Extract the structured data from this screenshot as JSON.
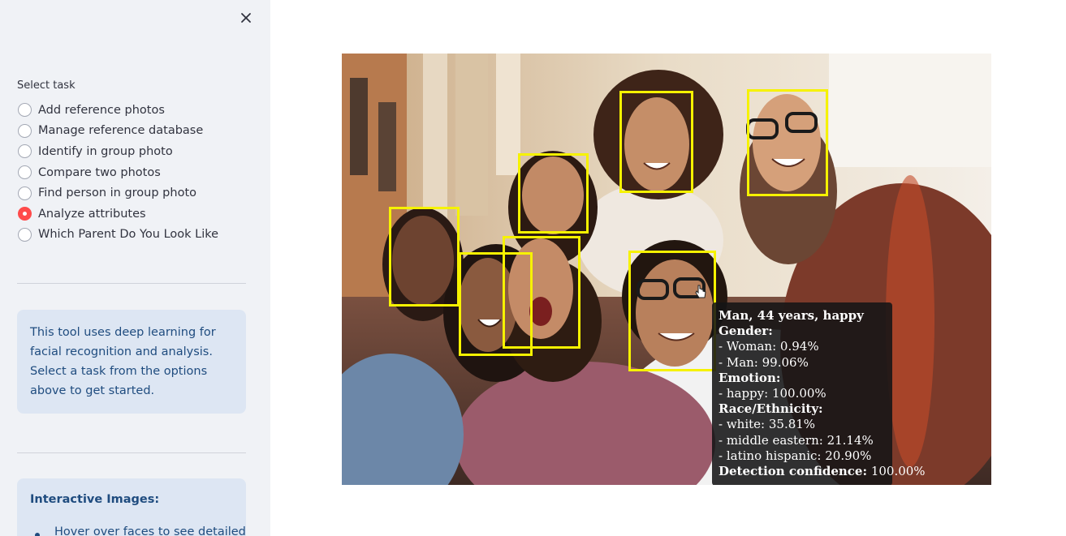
{
  "sidebar": {
    "task_label": "Select task",
    "tasks": [
      {
        "label": "Add reference photos",
        "selected": false
      },
      {
        "label": "Manage reference database",
        "selected": false
      },
      {
        "label": "Identify in group photo",
        "selected": false
      },
      {
        "label": "Compare two photos",
        "selected": false
      },
      {
        "label": "Find person in group photo",
        "selected": false
      },
      {
        "label": "Analyze attributes",
        "selected": true
      },
      {
        "label": "Which Parent Do You Look Like",
        "selected": false
      }
    ],
    "info_text": "This tool uses deep learning for facial recognition and analysis. Select a task from the options above to get started.",
    "interactive_title": "Interactive Images:",
    "interactive_bullet": "Hover over faces to see detailed"
  },
  "photo": {
    "box_color": "#f6f200",
    "face_count": 7
  },
  "tooltip": {
    "header": "Man, 44 years, happy",
    "gender_label": "Gender:",
    "gender_woman": "- Woman: 0.94%",
    "gender_man": "- Man: 99.06%",
    "emotion_label": "Emotion:",
    "emotion_happy": "- happy: 100.00%",
    "race_label": "Race/Ethnicity:",
    "race_white": "- white: 35.81%",
    "race_middle_eastern": "- middle eastern: 21.14%",
    "race_latino": "- latino hispanic: 20.90%",
    "confidence_label": "Detection confidence:",
    "confidence_value": "100.00%"
  },
  "colors": {
    "accent": "#ff4b4b",
    "sidebar_bg": "#f0f2f6",
    "info_bg": "#dde6f3",
    "info_text": "#1f4c7f"
  }
}
